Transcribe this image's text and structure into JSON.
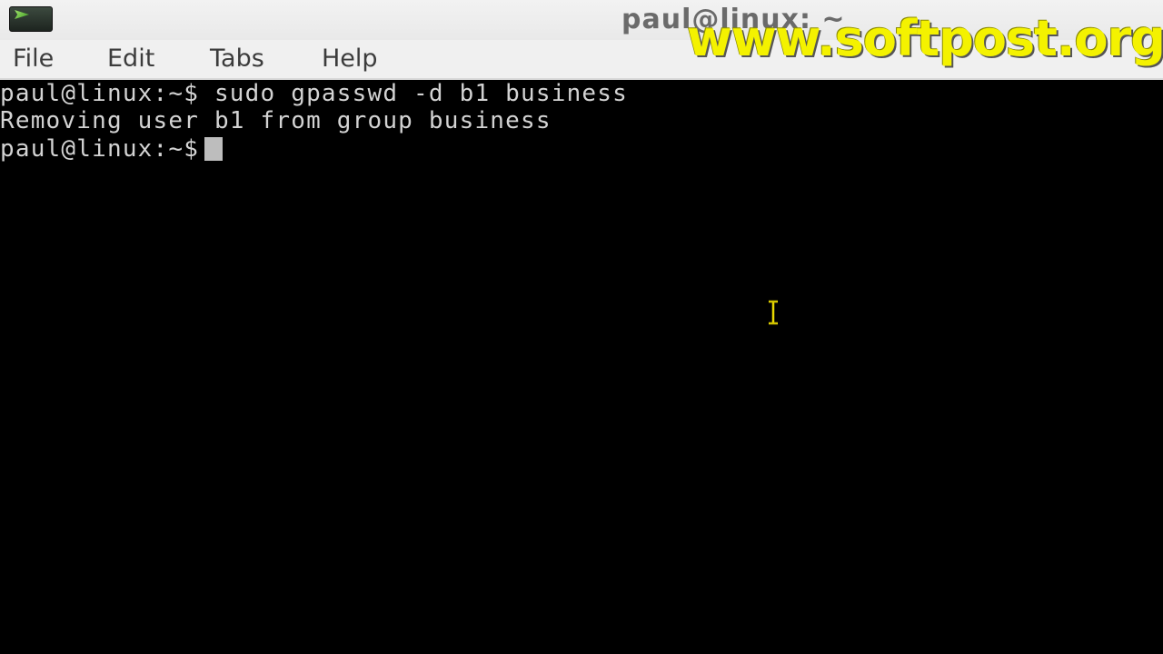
{
  "window": {
    "title": "paul@linux: ~",
    "icon": "terminal-icon",
    "watermark": "www.softpost.org"
  },
  "menubar": {
    "items": [
      {
        "label": "File"
      },
      {
        "label": "Edit"
      },
      {
        "label": "Tabs"
      },
      {
        "label": "Help"
      }
    ]
  },
  "terminal": {
    "prompt": "paul@linux:~$",
    "lines": [
      {
        "prompt": "paul@linux:~$",
        "text": " sudo gpasswd -d b1 business"
      },
      {
        "prompt": "",
        "text": "Removing user b1 from group business"
      },
      {
        "prompt": "paul@linux:~$",
        "text": ""
      }
    ],
    "colors": {
      "background": "#000000",
      "foreground": "#d3d3d3",
      "cursor": "#bdbdbd",
      "mouse_pointer": "#e8d800"
    }
  }
}
